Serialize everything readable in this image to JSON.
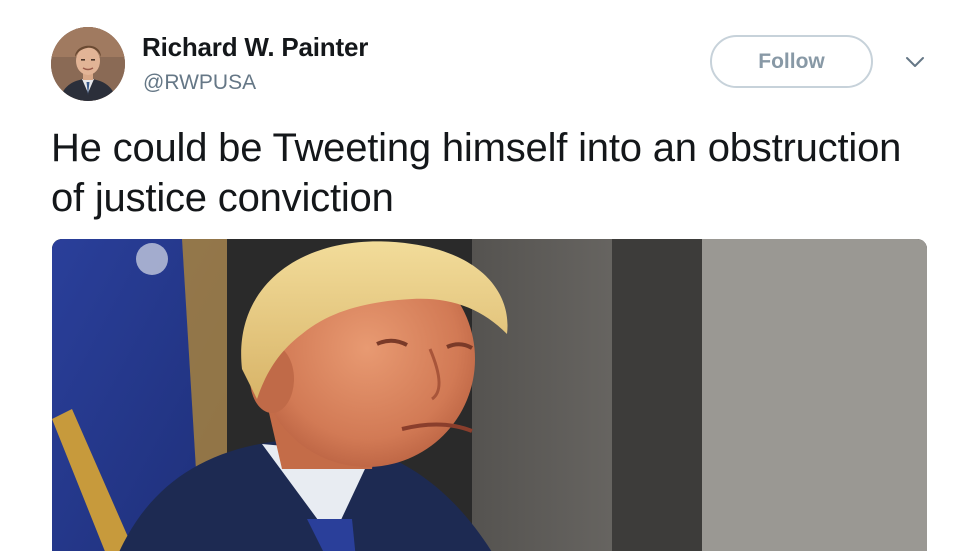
{
  "tweet": {
    "author": {
      "display_name": "Richard W. Painter",
      "handle": "@RWPUSA",
      "avatar_icon": "profile-photo"
    },
    "follow_label": "Follow",
    "menu_icon": "chevron-down-icon",
    "text": "He could be Tweeting himself into an obstruction of justice conviction",
    "media": {
      "kind": "photo",
      "icon": "photo"
    }
  },
  "colors": {
    "text_primary": "#14171a",
    "text_secondary": "#657786",
    "button_border": "#c7d2da",
    "button_text": "#8899a6",
    "background": "#ffffff"
  }
}
